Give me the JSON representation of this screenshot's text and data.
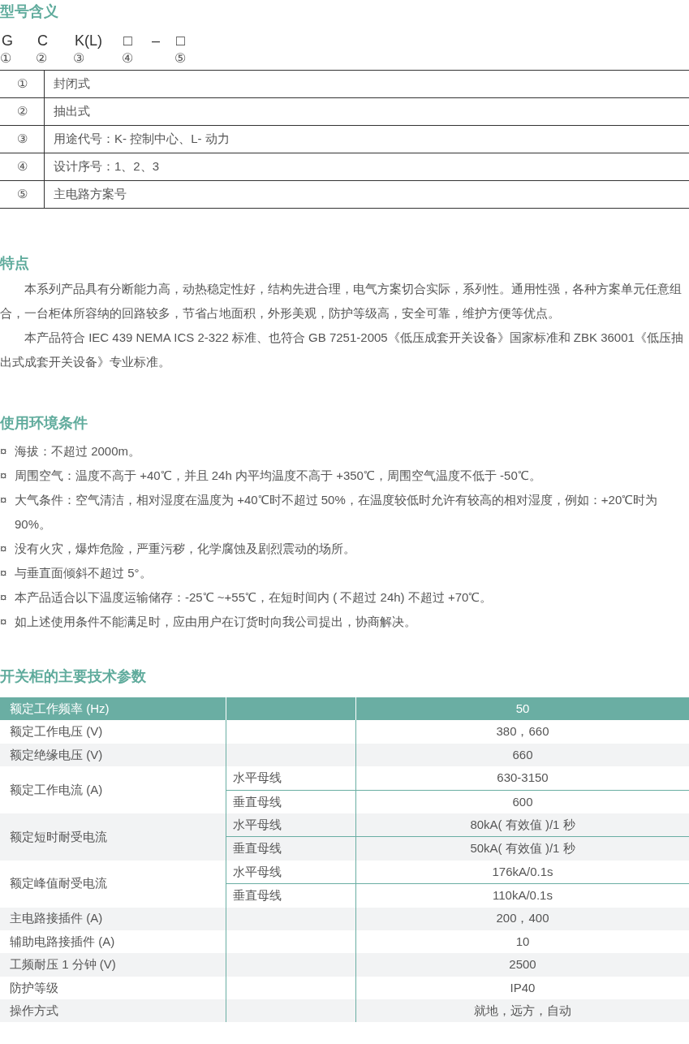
{
  "model_section": {
    "title": "型号含义",
    "code": [
      {
        "symbol": "G",
        "index": "①"
      },
      {
        "symbol": "C",
        "index": "②"
      },
      {
        "symbol": "K(L)",
        "index": "③"
      },
      {
        "symbol": "□",
        "index": "④"
      },
      {
        "symbol": "–"
      },
      {
        "symbol": "□",
        "index": "⑤"
      }
    ],
    "rows": [
      {
        "index": "①",
        "meaning": "封闭式"
      },
      {
        "index": "②",
        "meaning": "抽出式"
      },
      {
        "index": "③",
        "meaning": "用途代号：K- 控制中心、L- 动力"
      },
      {
        "index": "④",
        "meaning": "设计序号：1、2、3"
      },
      {
        "index": "⑤",
        "meaning": "主电路方案号"
      }
    ]
  },
  "features": {
    "title": "特点",
    "paragraphs": [
      "本系列产品具有分断能力高，动热稳定性好，结构先进合理，电气方案切合实际，系列性。通用性强，各种方案单元任意组合，一台柜体所容纳的回路较多，节省占地面积，外形美观，防护等级高，安全可靠，维护方便等优点。",
      "本产品符合 IEC 439 NEMA ICS 2-322 标准、也符合 GB 7251-2005《低压成套开关设备》国家标准和 ZBK 36001《低压抽出式成套开关设备》专业标准。"
    ]
  },
  "conditions": {
    "title": "使用环境条件",
    "items": [
      {
        "marker": "¤",
        "text": "海拔：不超过 2000m。"
      },
      {
        "marker": "¤",
        "text": "周围空气：温度不高于 +40℃，并且 24h 内平均温度不高于 +350℃，周围空气温度不低于 -50℃。"
      },
      {
        "marker": "¤",
        "text": "大气条件：空气清洁，相对湿度在温度为 +40℃时不超过 50%，在温度较低时允许有较高的相对湿度，例如：+20℃时为 90%。"
      },
      {
        "marker": "¤",
        "text": "没有火灾，爆炸危险，严重污秽，化学腐蚀及剧烈震动的场所。"
      },
      {
        "marker": "¤",
        "text": "与垂直面倾斜不超过 5°。"
      },
      {
        "marker": "¤",
        "text": "本产品适合以下温度运输储存：-25℃ ~+55℃，在短时间内 ( 不超过 24h) 不超过 +70℃。"
      },
      {
        "marker": "¤",
        "text": "如上述使用条件不能满足时，应由用户在订货时向我公司提出，协商解决。"
      }
    ]
  },
  "parameters": {
    "title": "开关柜的主要技术参数",
    "rows": [
      {
        "kind": "header",
        "name": "额定工作频率 (Hz)",
        "value": "50"
      },
      {
        "kind": "plain",
        "name": "额定工作电压 (V)",
        "value": "380，660"
      },
      {
        "kind": "plain",
        "name": "额定绝缘电压 (V)",
        "value": "660"
      },
      {
        "kind": "group",
        "name": "额定工作电流 (A)",
        "sub": [
          {
            "label": "水平母线",
            "value": "630-3150"
          },
          {
            "label": "垂直母线",
            "value": "600"
          }
        ]
      },
      {
        "kind": "group",
        "name": "额定短时耐受电流",
        "sub": [
          {
            "label": "水平母线",
            "value": "80kA( 有效值 )/1 秒"
          },
          {
            "label": "垂直母线",
            "value": "50kA( 有效值 )/1 秒"
          }
        ]
      },
      {
        "kind": "group",
        "name": "额定峰值耐受电流",
        "sub": [
          {
            "label": "水平母线",
            "value": "176kA/0.1s"
          },
          {
            "label": "垂直母线",
            "value": "110kA/0.1s"
          }
        ]
      },
      {
        "kind": "plain",
        "name": "主电路接插件 (A)",
        "value": "200，400"
      },
      {
        "kind": "plain",
        "name": "辅助电路接插件 (A)",
        "value": "10"
      },
      {
        "kind": "plain",
        "name": "工频耐压 1 分钟 (V)",
        "value": "2500"
      },
      {
        "kind": "plain",
        "name": "防护等级",
        "value": "IP40"
      },
      {
        "kind": "plain",
        "name": "操作方式",
        "value": "就地，远方，自动"
      }
    ]
  }
}
